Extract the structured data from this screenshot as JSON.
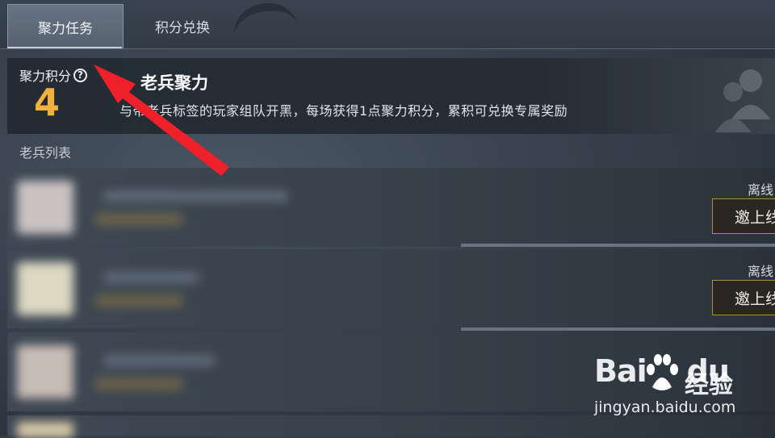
{
  "tabs": [
    {
      "label": "聚力任务",
      "active": true
    },
    {
      "label": "积分兑换",
      "active": false
    }
  ],
  "banner": {
    "points_label": "聚力积分",
    "points_value": "4",
    "title": "老兵聚力",
    "description": "与带老兵标签的玩家组队开黑，每场获得1点聚力积分，累积可兑换专属奖励"
  },
  "list": {
    "title": "老兵列表",
    "rows": [
      {
        "status": "离线",
        "button": "邀上线"
      },
      {
        "status": "离线",
        "button": "邀上线"
      },
      {
        "status": "",
        "button": ""
      }
    ]
  },
  "watermark": {
    "brand": "Bai du",
    "jingyan": "经验",
    "url": "jingyan.baidu.com"
  },
  "colors": {
    "accent_points": "#f0b23a",
    "annotation_arrow": "#f0202a",
    "button_border": "#b38a47"
  },
  "icons": [
    "help-circle-icon",
    "people-icon",
    "baidu-paw-icon",
    "arrow-annotation"
  ]
}
